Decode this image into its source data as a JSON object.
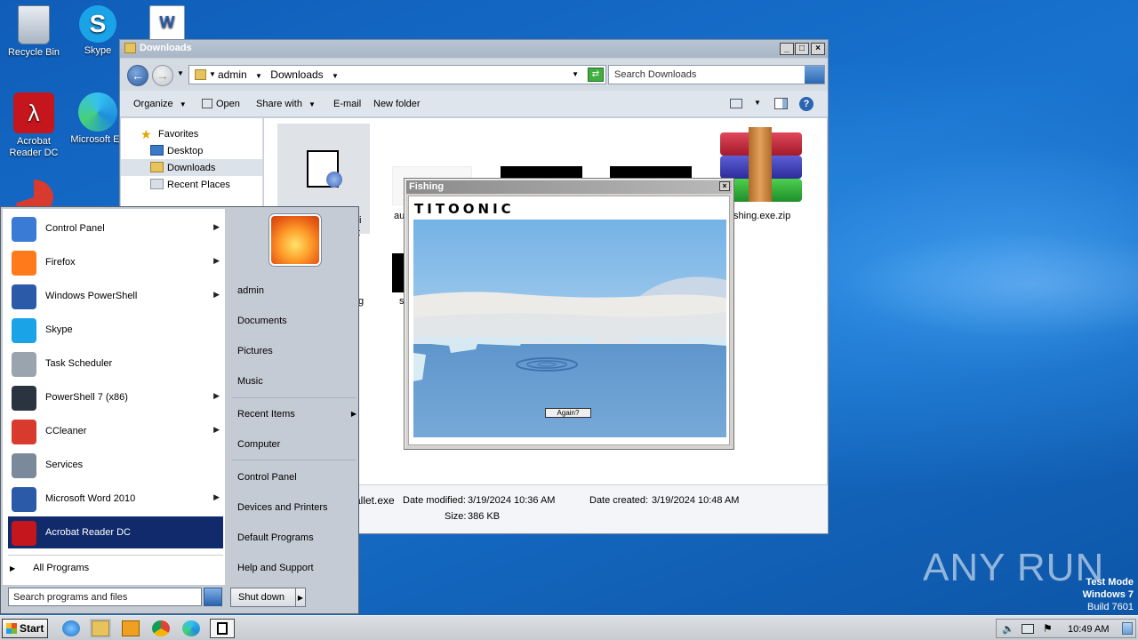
{
  "desktop": {
    "icons": [
      {
        "label": "Recycle Bin"
      },
      {
        "label": "Skype"
      },
      {
        "label": "Acrobat Reader DC"
      },
      {
        "label": "Microsoft Ed"
      }
    ],
    "watermark": {
      "brand": "ANY RUN",
      "mode": "Test Mode",
      "os": "Windows 7",
      "build": "Build 7601"
    }
  },
  "explorer": {
    "title": "Downloads",
    "breadcrumb": [
      "admin",
      "Downloads"
    ],
    "search_placeholder": "Search Downloads",
    "toolbar": {
      "organize": "Organize",
      "open": "Open",
      "share_with": "Share with",
      "email": "E-mail",
      "new_folder": "New folder"
    },
    "nav": {
      "favorites": "Favorites",
      "desktop": "Desktop",
      "downloads": "Downloads",
      "recent_places": "Recent Places"
    },
    "files": {
      "zip_name": "shing.exe.zip",
      "partial_1": "au",
      "partial_2": "fi",
      "partial_3": "t",
      "partial_4": "g",
      "partial_5": "s"
    },
    "status": {
      "name": "allet.exe",
      "modified_label": "Date modified:",
      "modified": "3/19/2024 10:36 AM",
      "created_label": "Date created:",
      "created": "3/19/2024 10:48 AM",
      "size_label": "Size:",
      "size": "386 KB"
    }
  },
  "fishing": {
    "title": "Fishing",
    "brand": "TITOONIC",
    "again": "Again?"
  },
  "start_menu": {
    "programs": [
      {
        "label": "Control Panel",
        "has_arrow": true,
        "color": "#3a7bd5"
      },
      {
        "label": "Firefox",
        "has_arrow": true,
        "color": "#ff7a1a"
      },
      {
        "label": "Windows PowerShell",
        "has_arrow": true,
        "color": "#2b5ba8"
      },
      {
        "label": "Skype",
        "has_arrow": false,
        "color": "#1ba3e8"
      },
      {
        "label": "Task Scheduler",
        "has_arrow": false,
        "color": "#9aa4ae"
      },
      {
        "label": "PowerShell 7 (x86)",
        "has_arrow": true,
        "color": "#2a3340"
      },
      {
        "label": "CCleaner",
        "has_arrow": true,
        "color": "#d83a2e"
      },
      {
        "label": "Services",
        "has_arrow": false,
        "color": "#7b8a9b"
      },
      {
        "label": "Microsoft Word 2010",
        "has_arrow": true,
        "color": "#2b5aa9"
      },
      {
        "label": "Acrobat Reader DC",
        "has_arrow": false,
        "color": "#c4161c"
      }
    ],
    "all_programs": "All Programs",
    "search_placeholder": "Search programs and files",
    "right": {
      "user": "admin",
      "documents": "Documents",
      "pictures": "Pictures",
      "music": "Music",
      "recent_items": "Recent Items",
      "computer": "Computer",
      "control_panel": "Control Panel",
      "devices_printers": "Devices and Printers",
      "default_programs": "Default Programs",
      "help_support": "Help and Support"
    },
    "shutdown": "Shut down"
  },
  "taskbar": {
    "start": "Start",
    "clock": "10:49 AM"
  }
}
